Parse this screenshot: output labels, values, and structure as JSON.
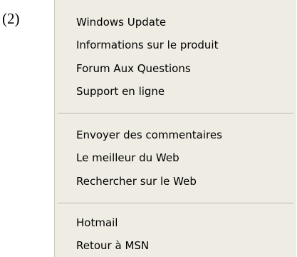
{
  "figure_label": "(2)",
  "menu": {
    "group1": [
      "Windows Update",
      "Informations sur le produit",
      "Forum Aux Questions",
      "Support en ligne"
    ],
    "group2": [
      "Envoyer des commentaires",
      "Le meilleur du Web",
      "Rechercher sur le Web"
    ],
    "group3": [
      "Hotmail",
      "Retour à MSN"
    ]
  }
}
